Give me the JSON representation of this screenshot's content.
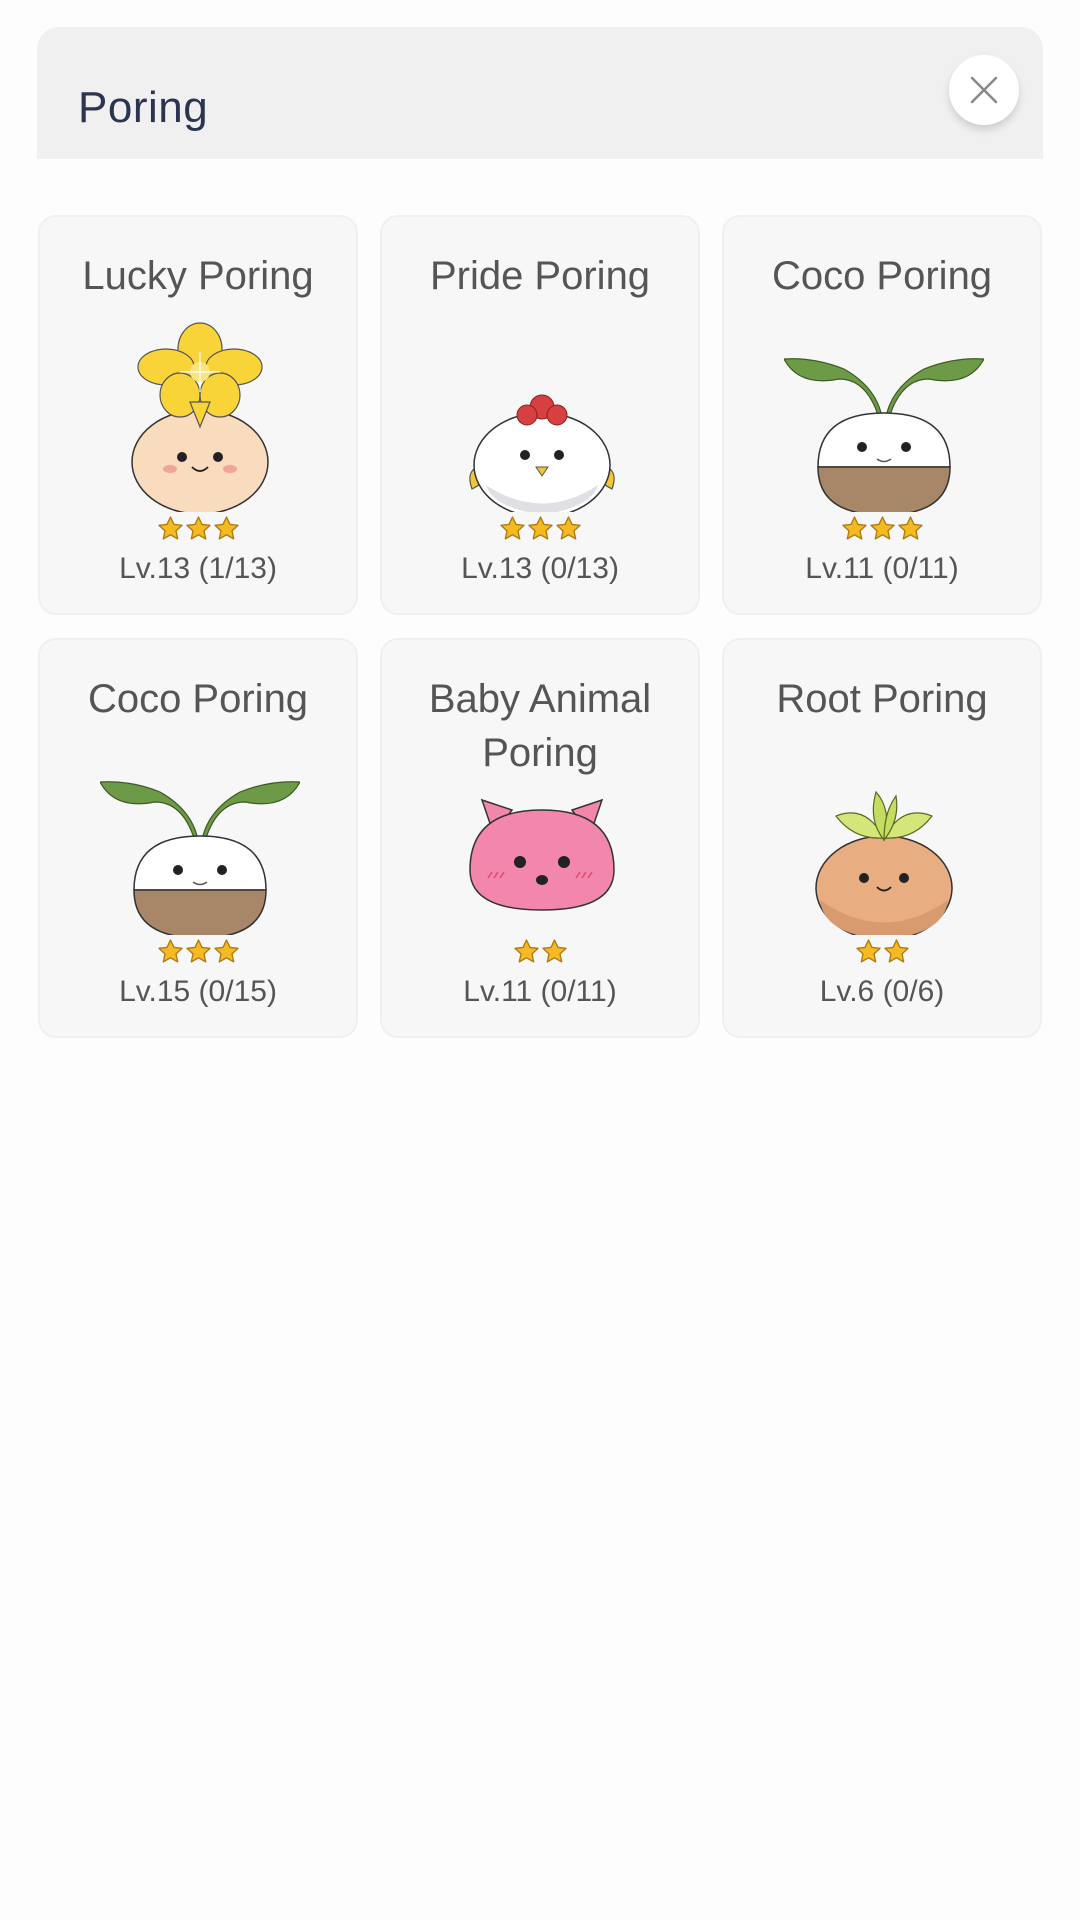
{
  "dialog": {
    "title": "Poring",
    "close_icon": "close-icon"
  },
  "cards": [
    {
      "name": "Lucky Poring",
      "level": "Lv.13 (1/13)",
      "stars": 3,
      "art": "lucky-poring-icon"
    },
    {
      "name": "Pride Poring",
      "level": "Lv.13 (0/13)",
      "stars": 3,
      "art": "pride-poring-icon"
    },
    {
      "name": "Coco Poring",
      "level": "Lv.11 (0/11)",
      "stars": 3,
      "art": "coco-poring-icon"
    },
    {
      "name": "Coco Poring",
      "level": "Lv.15 (0/15)",
      "stars": 3,
      "art": "coco-poring-icon"
    },
    {
      "name": "Baby Animal Poring",
      "level": "Lv.11 (0/11)",
      "stars": 2,
      "art": "baby-animal-poring-icon"
    },
    {
      "name": "Root Poring",
      "level": "Lv.6 (0/6)",
      "stars": 2,
      "art": "root-poring-icon"
    }
  ],
  "colors": {
    "header_bg": "#f0f0f0",
    "title": "#2b3550",
    "card_bg": "#f7f7f7",
    "card_text": "#555555",
    "star": "#f5b921"
  }
}
